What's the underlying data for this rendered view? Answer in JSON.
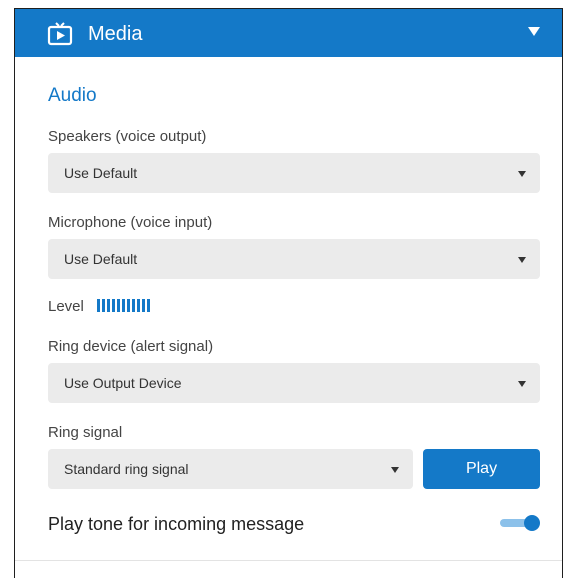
{
  "header": {
    "icon": "tv-icon",
    "title": "Media",
    "collapse_icon": "chevron-down-icon"
  },
  "audio": {
    "section_title": "Audio",
    "speakers": {
      "label": "Speakers (voice output)",
      "value": "Use Default"
    },
    "microphone": {
      "label": "Microphone (voice input)",
      "value": "Use Default"
    },
    "level": {
      "label": "Level",
      "bars": 11
    },
    "ring_device": {
      "label": "Ring device (alert signal)",
      "value": "Use Output Device"
    },
    "ring_signal": {
      "label": "Ring signal",
      "value": "Standard ring signal",
      "play_label": "Play"
    },
    "incoming_tone": {
      "label": "Play tone for incoming message",
      "enabled": true
    }
  },
  "colors": {
    "accent": "#1479c8",
    "field_bg": "#ebebeb",
    "toggle_track": "#8cc1ea"
  }
}
